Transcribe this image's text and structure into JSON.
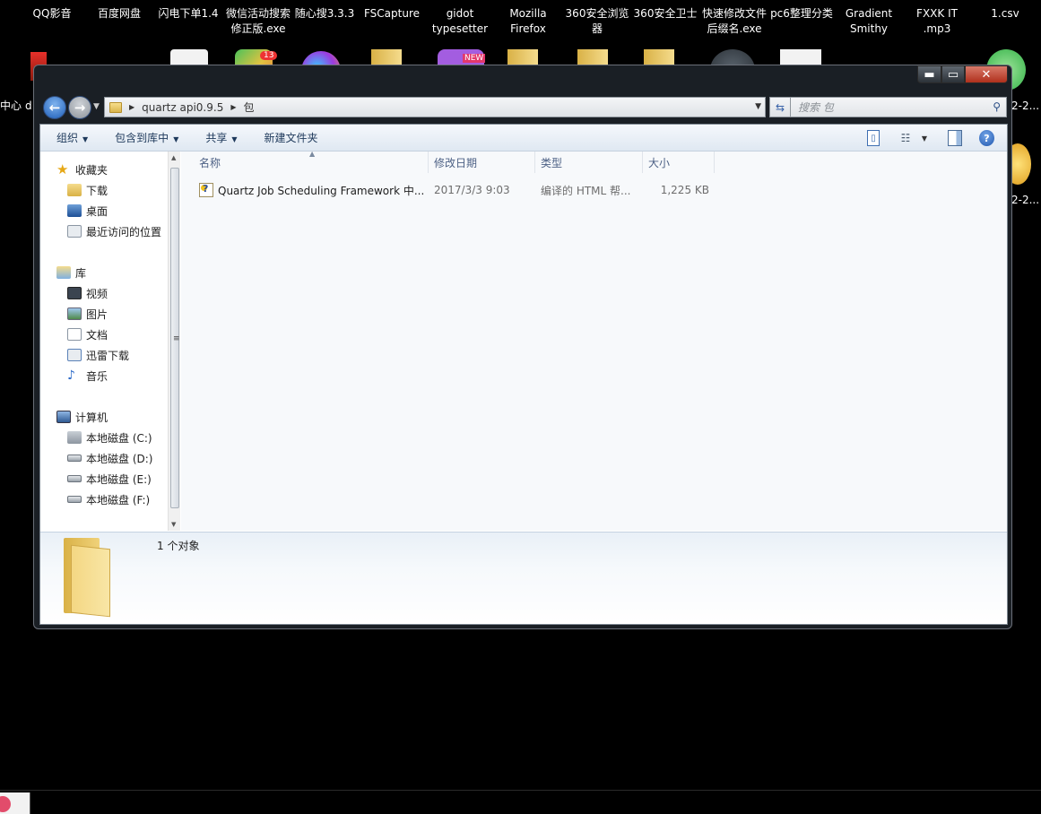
{
  "desktop": {
    "icons": [
      {
        "label_lines": [
          "QQ影音"
        ]
      },
      {
        "label_lines": [
          "百度网盘"
        ]
      },
      {
        "label_lines": [
          "闪电下单1.4"
        ]
      },
      {
        "label_lines": [
          "微信活动搜索",
          "修正版.exe"
        ]
      },
      {
        "label_lines": [
          "随心搜3.3.3"
        ]
      },
      {
        "label_lines": [
          "FSCapture"
        ]
      },
      {
        "label_lines": [
          "gidot",
          "typesetter"
        ]
      },
      {
        "label_lines": [
          "Mozilla",
          "Firefox"
        ]
      },
      {
        "label_lines": [
          "360安全浏览",
          "器"
        ]
      },
      {
        "label_lines": [
          "360安全卫士"
        ]
      },
      {
        "label_lines": [
          "快速修改文件",
          "后缀名.exe"
        ]
      },
      {
        "label_lines": [
          "pc6整理分类"
        ]
      },
      {
        "label_lines": [
          "Gradient",
          "Smithy"
        ]
      },
      {
        "label_lines": [
          "FXXK IT",
          ".mp3"
        ]
      },
      {
        "label_lines": [
          "1.csv"
        ]
      }
    ],
    "edge_left_text_1": "中心",
    "edge_left_text_2": "d",
    "edge_right_text_1": "2-2...",
    "edge_right_text_2": "2-2...",
    "badge_count": "13",
    "badge_new": "NEW",
    "taskbar_icon": "camera-icon"
  },
  "window": {
    "controls": {
      "minimize": "▬",
      "maximize": "▭",
      "close": "✕"
    },
    "nav": {
      "back_icon": "arrow-left-icon",
      "forward_icon": "arrow-right-icon"
    },
    "breadcrumb": [
      "quartz api0.9.5",
      "包"
    ],
    "search_placeholder": "搜索 包",
    "toolbar": {
      "organize": "组织",
      "include_in_library": "包含到库中",
      "share": "共享",
      "new_folder": "新建文件夹"
    },
    "sidebar": {
      "favorites": {
        "label": "收藏夹",
        "items": [
          "下载",
          "桌面",
          "最近访问的位置"
        ]
      },
      "libraries": {
        "label": "库",
        "items": [
          "视频",
          "图片",
          "文档",
          "迅雷下载",
          "音乐"
        ]
      },
      "computer": {
        "label": "计算机",
        "items": [
          "本地磁盘 (C:)",
          "本地磁盘 (D:)",
          "本地磁盘 (E:)",
          "本地磁盘 (F:)"
        ]
      }
    },
    "columns": {
      "name": "名称",
      "date": "修改日期",
      "type": "类型",
      "size": "大小"
    },
    "files": [
      {
        "name": "Quartz Job Scheduling Framework 中...",
        "date": "2017/3/3 9:03",
        "type": "编译的 HTML 帮...",
        "size": "1,225 KB"
      }
    ],
    "details": {
      "count": "1 个对象"
    }
  }
}
